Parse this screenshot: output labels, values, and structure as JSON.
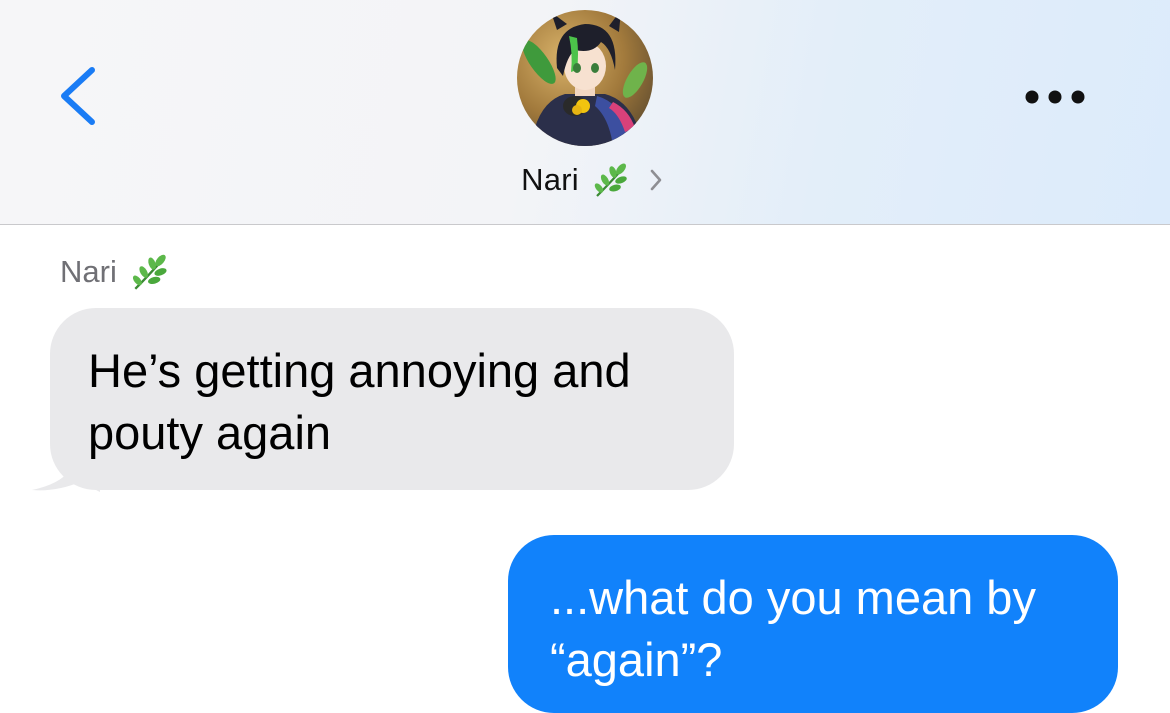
{
  "header": {
    "contact_name": "Nari",
    "name_emoji_icon": "herb-leaf-icon",
    "back_icon": "chevron-left-icon",
    "detail_icon": "chevron-right-icon",
    "more_icon": "ellipsis-icon",
    "avatar": "anime-character-avatar",
    "accent_color": "#1a7cf5"
  },
  "messages": [
    {
      "direction": "incoming",
      "sender": "Nari",
      "sender_emoji_icon": "herb-leaf-icon",
      "lines": [
        "He’s getting annoying and",
        "pouty again"
      ],
      "bubble_color": "#e9e9eb"
    },
    {
      "direction": "outgoing",
      "lines": [
        "...what do you mean by",
        "“again”?"
      ],
      "bubble_color": "#1182fb"
    }
  ]
}
